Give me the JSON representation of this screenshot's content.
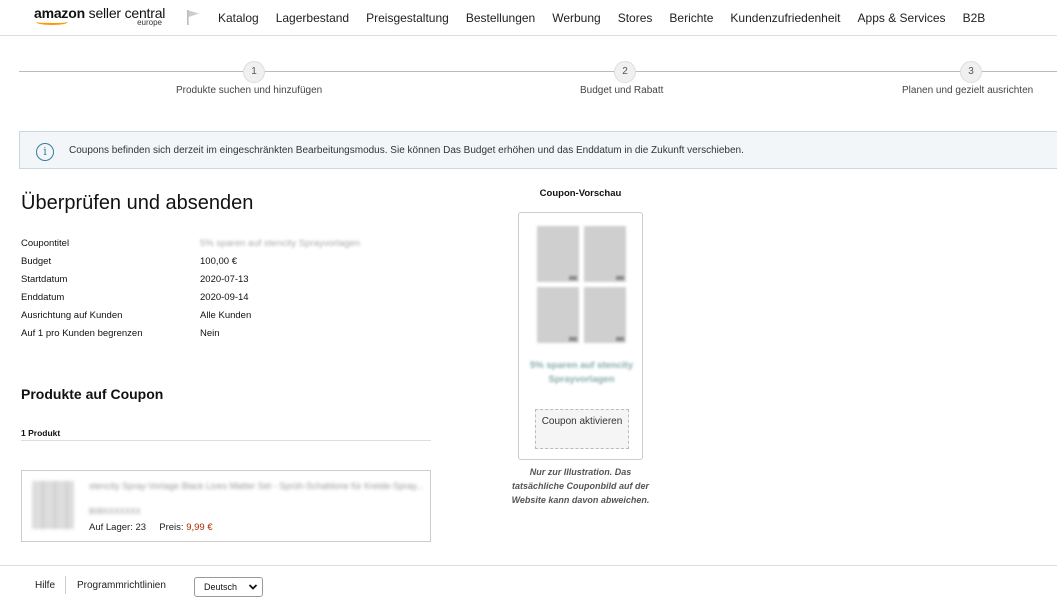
{
  "header": {
    "logo_main": "amazon",
    "logo_product": "seller central",
    "logo_region": "europe",
    "nav": [
      "Katalog",
      "Lagerbestand",
      "Preisgestaltung",
      "Bestellungen",
      "Werbung",
      "Stores",
      "Berichte",
      "Kundenzufriedenheit",
      "Apps & Services",
      "B2B"
    ]
  },
  "stepper": {
    "steps": [
      {
        "number": "1",
        "label": "Produkte suchen und hinzufügen"
      },
      {
        "number": "2",
        "label": "Budget und Rabatt"
      },
      {
        "number": "3",
        "label": "Planen und gezielt ausrichten"
      }
    ]
  },
  "banner": {
    "icon": "info-icon",
    "text": "Coupons befinden sich derzeit im eingeschränkten Bearbeitungsmodus. Sie können Das Budget erhöhen und das Enddatum in die Zukunft verschieben."
  },
  "review": {
    "title": "Überprüfen und absenden",
    "rows": [
      {
        "label": "Coupontitel",
        "value": "5% sparen auf stencity Sprayvorlagen"
      },
      {
        "label": "Budget",
        "value": "100,00 €"
      },
      {
        "label": "Startdatum",
        "value": "2020-07-13"
      },
      {
        "label": "Enddatum",
        "value": "2020-09-14"
      },
      {
        "label": "Ausrichtung auf Kunden",
        "value": "Alle Kunden"
      },
      {
        "label": "Auf 1 pro Kunden begrenzen",
        "value": "Nein"
      }
    ]
  },
  "products": {
    "title": "Produkte auf Coupon",
    "count": "1 Produkt",
    "items": [
      {
        "title": "stencity Spray-Vorlage Black Lives Matter Set - Sprüh-Schablone für Kreide-Spray...",
        "asin": "B08XXXXXXX",
        "stock_label": "Auf Lager:",
        "stock": "23",
        "price_label": "Preis:",
        "price": "9,99 €"
      }
    ]
  },
  "preview": {
    "title": "Coupon-Vorschau",
    "text": "5% sparen auf stencity Sprayvorlagen",
    "button_label": "Coupon aktivieren",
    "note": "Nur zur Illustration. Das tatsächliche Couponbild auf der Website kann davon abweichen."
  },
  "footer": {
    "help": "Hilfe",
    "policies": "Programmrichtlinien",
    "language": "Deutsch"
  },
  "colors": {
    "info_accent": "#3a7c9c",
    "price": "#b12704",
    "logo_smile": "#ff9900"
  }
}
